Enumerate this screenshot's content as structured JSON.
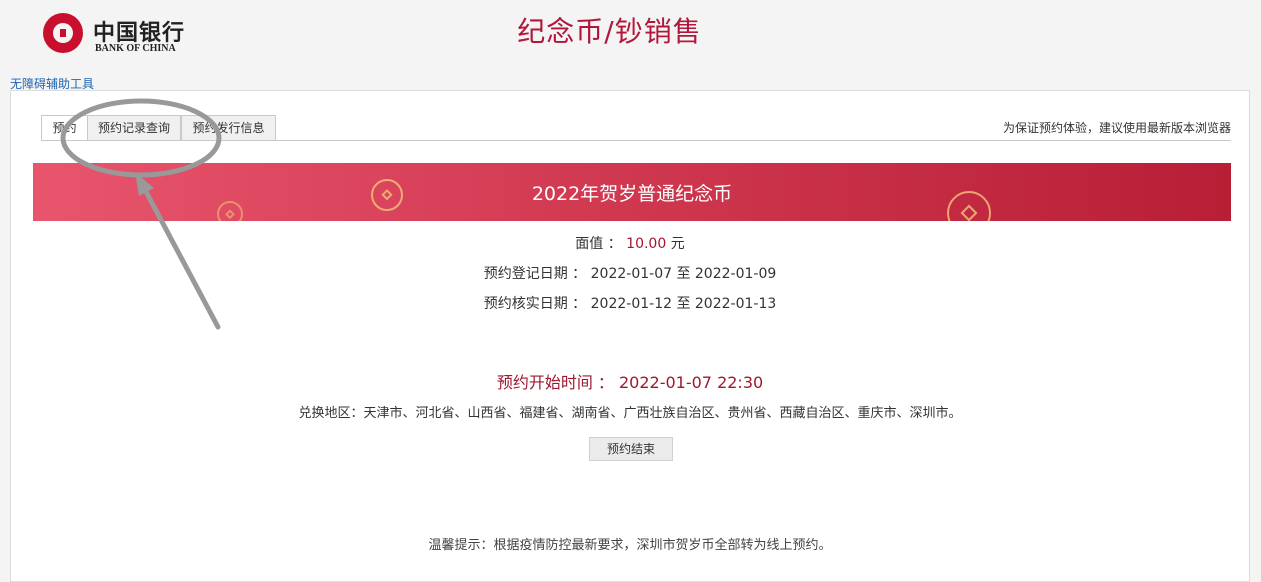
{
  "header": {
    "logo_cn": "中国银行",
    "logo_en": "BANK OF CHINA",
    "page_title": "纪念币/钞销售"
  },
  "accessibility_link": "无障碍辅助工具",
  "tabs": [
    {
      "label": "预约",
      "active": true
    },
    {
      "label": "预约记录查询",
      "active": false
    },
    {
      "label": "预约发行信息",
      "active": false
    }
  ],
  "browser_tip": "为保证预约体验，建议使用最新版本浏览器",
  "coin": {
    "title": "2022年贺岁普通纪念币",
    "face_value_label": "面值 ：",
    "face_value": "10.00",
    "face_value_unit": "元",
    "register_label": "预约登记日期 ：",
    "register_range": "2022-01-07 至 2022-01-09",
    "verify_label": "预约核实日期 ：",
    "verify_range": "2022-01-12 至 2022-01-13",
    "start_label": "预约开始时间 ：",
    "start_time": "2022-01-07 22:30",
    "region": "兑换地区：天津市、河北省、山西省、福建省、湖南省、广西壮族自治区、贵州省、西藏自治区、重庆市、深圳市。",
    "status_button": "预约结束"
  },
  "notice": "温馨提示：根据疫情防控最新要求，深圳市贺岁币全部转为线上预约。",
  "colors": {
    "brand_red": "#c8102e",
    "title_red": "#b0173a",
    "banner_left": "#e8556d",
    "banner_right": "#b81f36",
    "link_blue": "#1e64b4",
    "annotation_gray": "#999999"
  },
  "icons": [
    "bank-of-china-logo-icon",
    "coin-decoration-icon"
  ]
}
